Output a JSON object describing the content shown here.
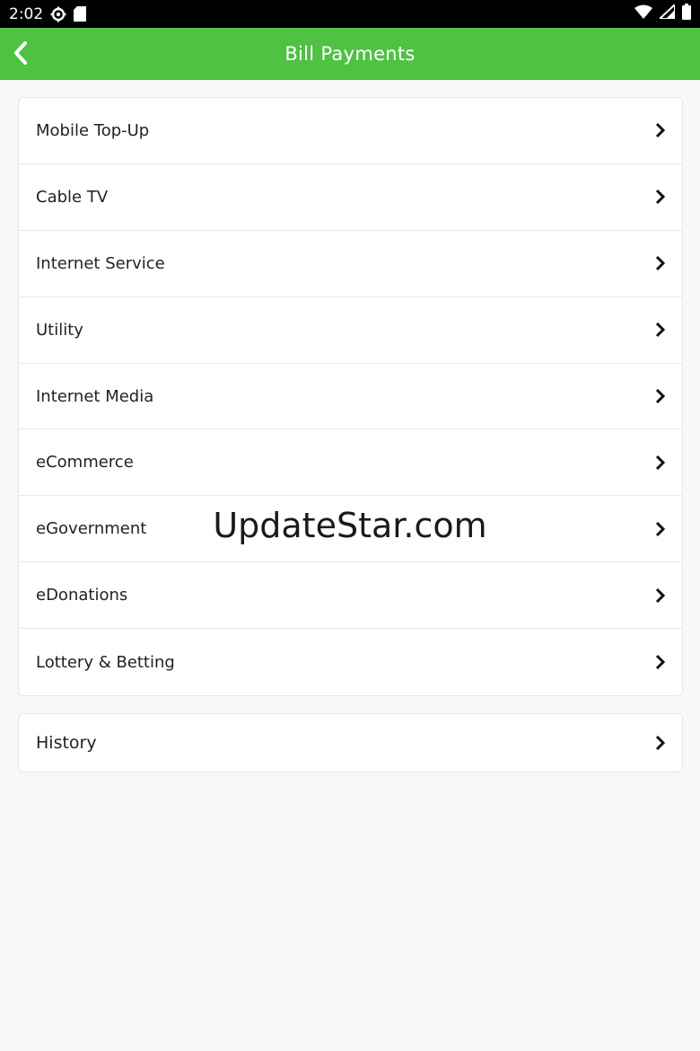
{
  "status_bar": {
    "time": "2:02",
    "icons": [
      "settings-icon",
      "sd-card-icon",
      "wifi-icon",
      "signal-icon",
      "battery-icon"
    ]
  },
  "app_bar": {
    "title": "Bill Payments",
    "back_icon": "chevron-left-icon",
    "color": "#4fc143"
  },
  "menu": {
    "items": [
      {
        "label": "Mobile Top-Up"
      },
      {
        "label": "Cable TV"
      },
      {
        "label": "Internet Service"
      },
      {
        "label": "Utility"
      },
      {
        "label": "Internet Media"
      },
      {
        "label": "eCommerce"
      },
      {
        "label": "eGovernment"
      },
      {
        "label": "eDonations"
      },
      {
        "label": "Lottery & Betting"
      }
    ]
  },
  "history": {
    "label": "History"
  },
  "watermark": "UpdateStar.com"
}
